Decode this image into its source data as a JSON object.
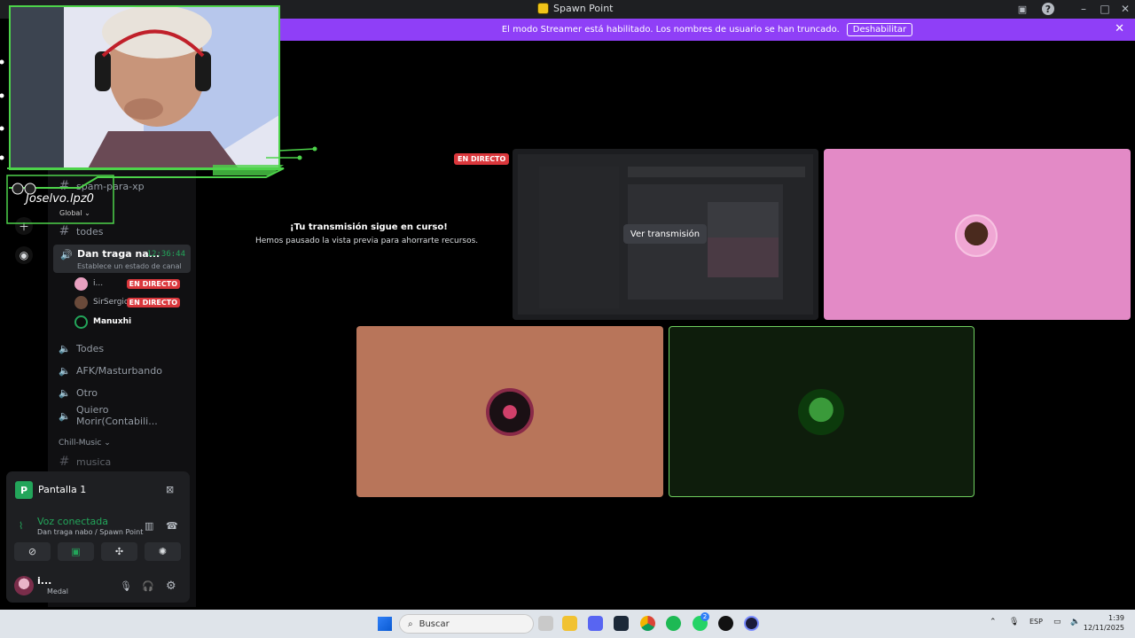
{
  "window": {
    "title": "Spawn Point"
  },
  "banner": {
    "text": "El modo Streamer está habilitado. Los nombres de usuario se han truncado.",
    "button": "Deshabilitar"
  },
  "overlay": {
    "name": "Joselvo.lpz0",
    "sub": "Global"
  },
  "sidebar": {
    "channels": [
      {
        "icon": "hash",
        "label": "spam-para-xp"
      },
      {
        "icon": "hash",
        "label": "todes"
      }
    ],
    "active_voice": {
      "label": "Dan traga na...",
      "timer": "12:36:44",
      "status": "Establece un estado de canal"
    },
    "voice_users": [
      {
        "name": "i...",
        "live": "EN DIRECTO",
        "color": "#e8a0c0"
      },
      {
        "name": "SirSergio",
        "live": "EN DIRECTO",
        "color": "#6a4a3a"
      },
      {
        "name": "Manuxhi",
        "live": "",
        "color": "#1a5a1a"
      }
    ],
    "voice_channels": [
      {
        "label": "Todes"
      },
      {
        "label": "AFK/Masturbando"
      },
      {
        "label": "Otro"
      },
      {
        "label": "Quiero Morir(Contabili..."
      }
    ],
    "category": "Chill-Music",
    "music_channel": "musica"
  },
  "user_panel": {
    "screen_label": "Pantalla 1",
    "voice_status": "Voz conectada",
    "voice_path": "Dan traga nabo / Spawn Point",
    "username": "i...",
    "subtext": "Medal"
  },
  "main": {
    "live_tag": "EN DIRECTO",
    "paused_title": "¡Tu transmisión sigue en curso!",
    "paused_sub": "Hemos pausado la vista previa para ahorrarte recursos.",
    "view_button": "Ver transmisión"
  },
  "taskbar": {
    "search_placeholder": "Buscar",
    "lang": "ESP",
    "time": "1:39",
    "date": "12/11/2025",
    "badge": "2"
  },
  "colors": {
    "accent": "#8f3ff7",
    "live": "#da373c",
    "connected": "#23a55a",
    "tile_pink": "#e38ac6",
    "tile_terracotta": "#b8755a",
    "tile_dark_green": "#0e1d0c"
  }
}
